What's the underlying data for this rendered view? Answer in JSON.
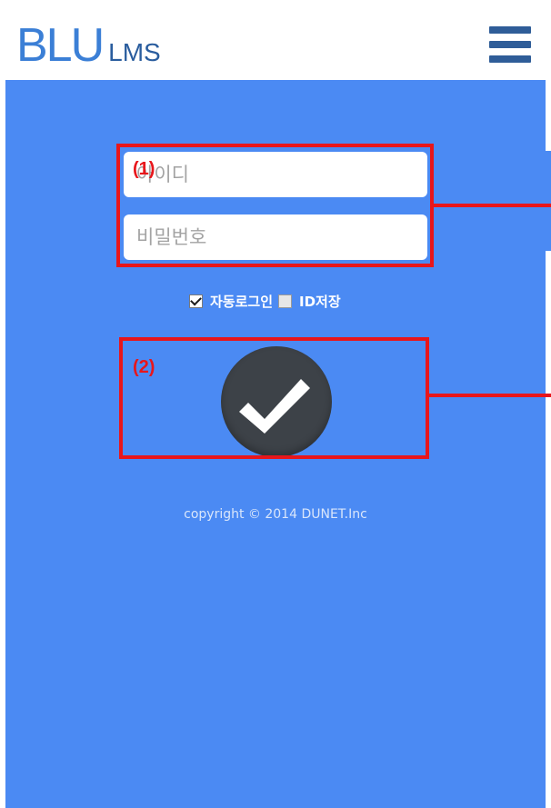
{
  "header": {
    "logo_main": "BLU",
    "logo_sub": "LMS",
    "menu_icon": "hamburger-menu-icon"
  },
  "login_form": {
    "id_placeholder": "아이디",
    "password_placeholder": "비밀번호",
    "auto_login_label": "자동로그인",
    "auto_login_checked": true,
    "save_id_label": "ID저장",
    "save_id_checked": false,
    "submit_icon": "checkmark-icon"
  },
  "footer": {
    "copyright": "copyright © 2014 DUNET.Inc"
  },
  "annotations": {
    "label_1": "(1)",
    "label_2": "(2)"
  },
  "colors": {
    "background": "#4b8af3",
    "logo": "#3b7fd6",
    "menu": "#2f5d98",
    "button": "#3d4248",
    "annotation": "#e8161b"
  }
}
